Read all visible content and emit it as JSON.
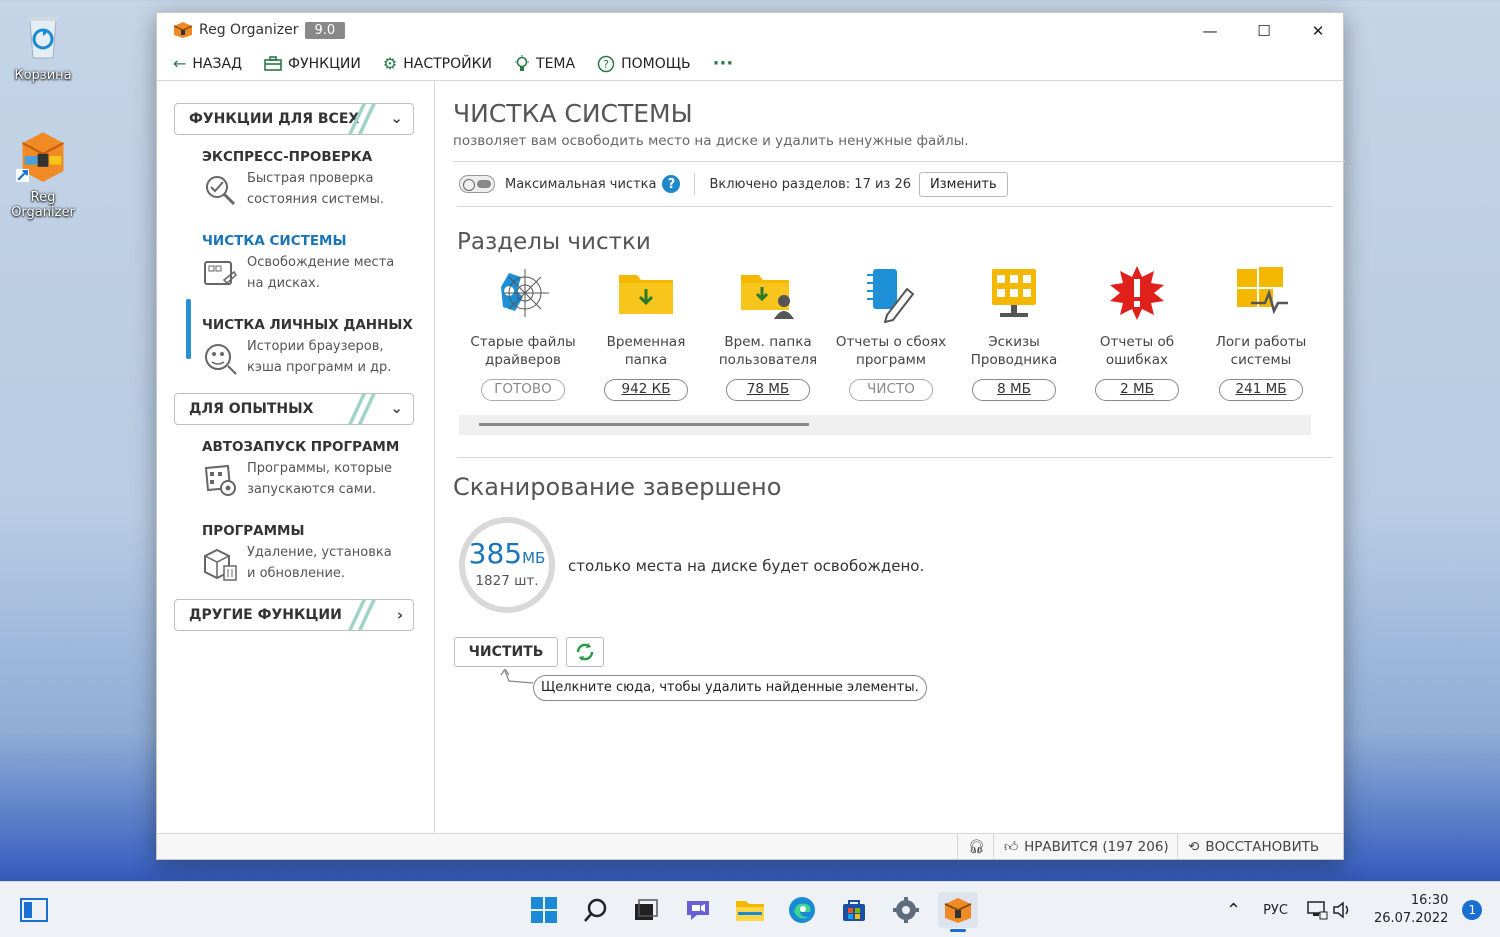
{
  "desktop": {
    "recycle_label": "Корзина",
    "shortcut_label_1": "Reg",
    "shortcut_label_2": "Organizer"
  },
  "window": {
    "app_name": "Reg Organizer",
    "version": "9.0",
    "controls": {
      "minimize": "—",
      "maximize": "☐",
      "close": "✕"
    }
  },
  "menu": {
    "back": "НАЗАД",
    "functions": "ФУНКЦИИ",
    "settings": "НАСТРОЙКИ",
    "theme": "ТЕМА",
    "help": "ПОМОЩЬ",
    "more": "···"
  },
  "sidebar": {
    "section_all": "ФУНКЦИИ ДЛЯ ВСЕХ",
    "section_advanced": "ДЛЯ ОПЫТНЫХ",
    "section_other": "ДРУГИЕ ФУНКЦИИ",
    "items": [
      {
        "title": "ЭКСПРЕСС-ПРОВЕРКА",
        "desc1": "Быстрая проверка",
        "desc2": "состояния системы.",
        "icon": "magnifier-check-icon"
      },
      {
        "title": "ЧИСТКА СИСТЕМЫ",
        "desc1": "Освобождение места",
        "desc2": "на дисках.",
        "icon": "disk-cleanup-icon",
        "active": true
      },
      {
        "title": "ЧИСТКА ЛИЧНЫХ ДАННЫХ",
        "desc1": "Истории браузеров,",
        "desc2": "кэша программ и др.",
        "icon": "privacy-icon"
      },
      {
        "title": "АВТОЗАПУСК ПРОГРАММ",
        "desc1": "Программы, которые",
        "desc2": "запускаются сами.",
        "icon": "startup-icon"
      },
      {
        "title": "ПРОГРАММЫ",
        "desc1": "Удаление, установка",
        "desc2": "и обновление.",
        "icon": "programs-box-icon"
      }
    ]
  },
  "main": {
    "title": "ЧИСТКА СИСТЕМЫ",
    "subtitle": "позволяет вам освободить место на диске и удалить ненужные файлы.",
    "max_clean_label": "Максимальная чистка",
    "sections_enabled": "Включено разделов: 17 из 26",
    "change_button": "Изменить",
    "sections_title": "Разделы чистки",
    "tiles": [
      {
        "label1": "Старые файлы",
        "label2": "драйверов",
        "value": "ГОТОВО",
        "icon": "driver-cobweb-icon",
        "link": false
      },
      {
        "label1": "Временная",
        "label2": "папка",
        "value": "942 КБ",
        "icon": "temp-folder-icon",
        "link": true
      },
      {
        "label1": "Врем. папка",
        "label2": "пользователя",
        "value": "78 МБ",
        "icon": "user-temp-folder-icon",
        "link": true
      },
      {
        "label1": "Отчеты о сбоях",
        "label2": "программ",
        "value": "ЧИСТО",
        "icon": "crash-report-icon",
        "link": false
      },
      {
        "label1": "Эскизы",
        "label2": "Проводника",
        "value": "8 МБ",
        "icon": "thumbnails-icon",
        "link": true
      },
      {
        "label1": "Отчеты об",
        "label2": "ошибках",
        "value": "2 МБ",
        "icon": "error-report-icon",
        "link": true
      },
      {
        "label1": "Логи работы",
        "label2": "системы",
        "value": "241 МБ",
        "icon": "system-logs-icon",
        "link": true
      }
    ],
    "scan_title": "Сканирование завершено",
    "ring_value": "385",
    "ring_unit": "МБ",
    "ring_count": "1827 шт.",
    "scan_text": "столько места на диске будет освобождено.",
    "clean_button": "ЧИСТИТЬ",
    "tooltip": "Щелкните сюда, чтобы удалить найденные элементы."
  },
  "statusbar": {
    "likes": "НРАВИТСЯ (197 206)",
    "restore": "ВОССТАНОВИТЬ"
  },
  "taskbar": {
    "lang": "РУС",
    "time": "16:30",
    "date": "26.07.2022",
    "notifications": "1"
  },
  "colors": {
    "accent": "#1a75b8",
    "icon_green": "#2b7a46",
    "folder_yellow": "#f5b800",
    "error_red": "#e0201b"
  }
}
